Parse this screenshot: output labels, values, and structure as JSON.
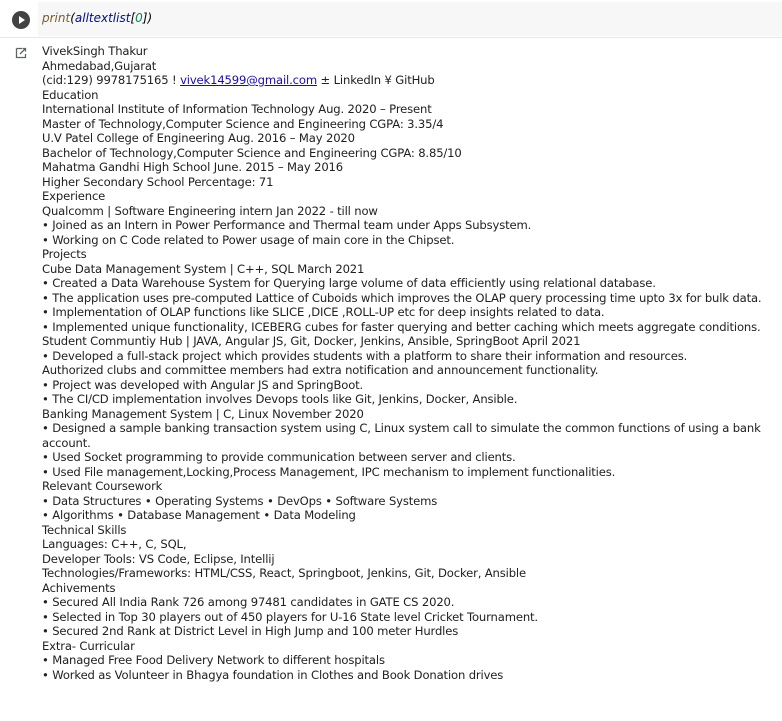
{
  "code": {
    "func": "print",
    "arg": "alltextlist",
    "index": "0"
  },
  "output": {
    "lines": [
      "VivekSingh Thakur",
      "Ahmedabad,Gujarat",
      "__CONTACT__",
      "Education",
      "International Institute of Information Technology Aug. 2020 – Present",
      "Master of Technology,Computer Science and Engineering CGPA: 3.35/4",
      "U.V Patel College of Engineering Aug. 2016 – May 2020",
      "Bachelor of Technology,Computer Science and Engineering CGPA: 8.85/10",
      "Mahatma Gandhi High School June. 2015 – May 2016",
      "Higher Secondary School Percentage: 71",
      "Experience",
      "Qualcomm | Software Engineering intern Jan 2022 - till now",
      "• Joined as an Intern in Power Performance and Thermal team under Apps Subsystem.",
      "• Working on C Code related to Power usage of main core in the Chipset.",
      "Projects",
      "Cube Data Management System | C++, SQL March 2021",
      "• Created a Data Warehouse System for Querying large volume of data efficiently using relational database.",
      "• The application uses pre-computed Lattice of Cuboids which improves the OLAP query processing time upto 3x for bulk data.",
      "• Implementation of OLAP functions like SLICE ,DICE ,ROLL-UP etc for deep insights related to data.",
      "• Implemented unique functionality, ICEBERG cubes for faster querying and better caching which meets aggregate conditions.",
      "Student Communtiy Hub | JAVA, Angular JS, Git, Docker, Jenkins, Ansible, SpringBoot April 2021",
      "• Developed a full-stack project which provides students with a platform to share their information and resources.",
      "Authorized clubs and committee members had extra notification and announcement functionality.",
      "• Project was developed with Angular JS and SpringBoot.",
      "• The CI/CD implementation involves Devops tools like Git, Jenkins, Docker, Ansible.",
      "Banking Management System | C, Linux November 2020",
      "• Designed a sample banking transaction system using C, Linux system call to simulate the common functions of using a bank account.",
      "• Used Socket programming to provide communication between server and clients.",
      "• Used File management,Locking,Process Management, IPC mechanism to implement functionalities.",
      "Relevant Coursework",
      "• Data Structures • Operating Systems • DevOps • Software Systems",
      "• Algorithms • Database Management • Data Modeling",
      "Technical Skills",
      "Languages: C++, C, SQL,",
      "Developer Tools: VS Code, Eclipse, Intellij",
      "Technologies/Frameworks: HTML/CSS, React, Springboot, Jenkins, Git, Docker, Ansible",
      "Achivements",
      "• Secured All India Rank 726 among 97481 candidates in GATE CS 2020.",
      "• Selected in Top 30 players out of 450 players for U-16 State level Cricket Tournament.",
      "• Secured 2nd Rank at District Level in High Jump and 100 meter Hurdles",
      "Extra- Curricular",
      "• Managed Free Food Delivery Network to different hospitals",
      "• Worked as Volunteer in Bhagya foundation in Clothes and Book Donation drives"
    ],
    "contact": {
      "prefix": "(cid:129) 9978175165 ! ",
      "email": "vivek14599@gmail.com",
      "suffix": " ± LinkedIn ¥ GitHub"
    }
  }
}
